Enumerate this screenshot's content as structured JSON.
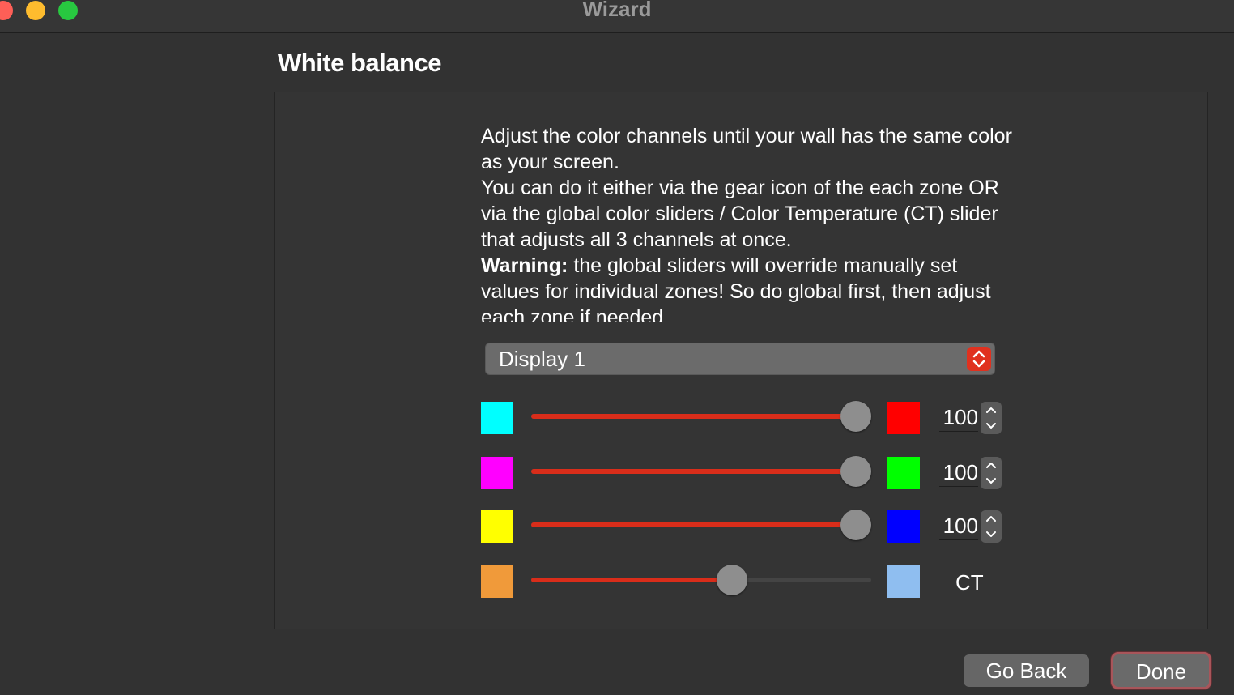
{
  "window": {
    "title": "Wizard"
  },
  "page": {
    "title": "White balance"
  },
  "instructions": {
    "line1": "Adjust the color channels until your wall has the same color as your screen.",
    "line2": "You can do it either via the gear icon of the each zone OR via the global color sliders / Color Temperature (CT) slider that adjusts all 3 channels at once.",
    "warning_label": "Warning:",
    "warning_text": " the global sliders will override manually set values for individual zones! So do global first, then adjust each zone if needed."
  },
  "display_select": {
    "value": "Display 1"
  },
  "channels": [
    {
      "name": "red",
      "value": "100",
      "level": 100,
      "left_color": "#00ffff",
      "right_color": "#ff0000"
    },
    {
      "name": "green",
      "value": "100",
      "level": 100,
      "left_color": "#ff00ff",
      "right_color": "#00ff00"
    },
    {
      "name": "blue",
      "value": "100",
      "level": 100,
      "left_color": "#ffff00",
      "right_color": "#0000ff"
    }
  ],
  "ct": {
    "label": "CT",
    "level_percent": 60,
    "left_color": "#f09a3a",
    "right_color": "#8fbef0"
  },
  "buttons": {
    "back": "Go Back",
    "done": "Done"
  },
  "colors": {
    "accent": "#d92d1a",
    "select_arrow": "#e0311f"
  }
}
